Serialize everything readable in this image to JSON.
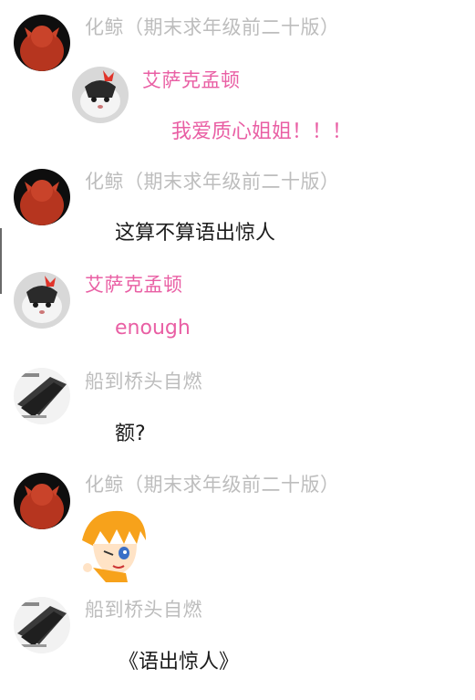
{
  "messages": [
    {
      "sender": "化鲸（期末求年级前二十版）"
    },
    {
      "sender": "艾萨克孟顿",
      "text": "我爱质心姐姐！！！"
    },
    {
      "sender": "化鲸（期末求年级前二十版）",
      "text": "这算不算语出惊人"
    },
    {
      "sender": "艾萨克孟顿",
      "text": "enough"
    },
    {
      "sender": "船到桥头自燃",
      "text": "额?"
    },
    {
      "sender": "化鲸（期末求年级前二十版）"
    },
    {
      "sender": "船到桥头自燃",
      "text": "《语出惊人》"
    }
  ],
  "colors": {
    "name_gray": "#bdbdbd",
    "name_pink": "#e95fa4",
    "text_dark": "#1c1c1c"
  }
}
